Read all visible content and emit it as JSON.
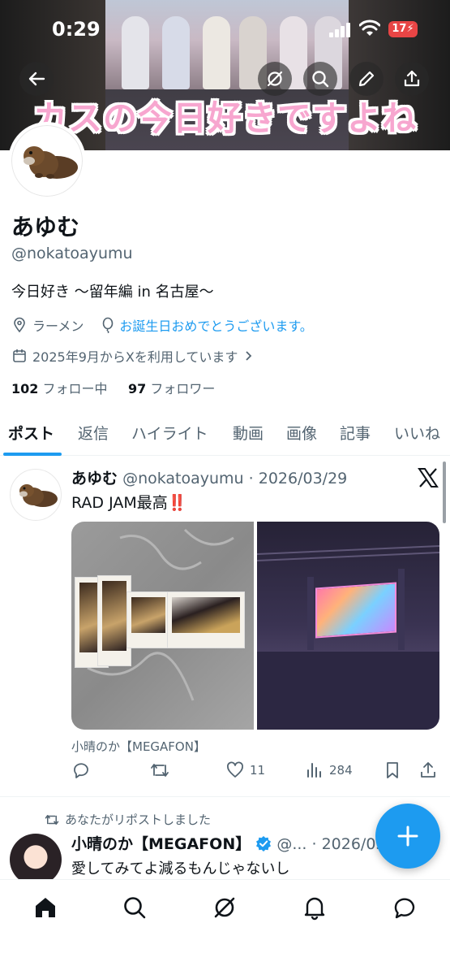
{
  "status_bar": {
    "time": "0:29",
    "battery": "17"
  },
  "banner": {
    "caption": "カスの今日好きですよね"
  },
  "profile": {
    "name": "あゆむ",
    "handle": "@nokatoayumu",
    "bio": "今日好き 〜留年編 in 名古屋〜",
    "location": "ラーメン",
    "birthday": "お誕生日おめでとうございます。",
    "joined": "2025年9月からXを利用しています",
    "following_count": "102",
    "following_label": "フォロー中",
    "followers_count": "97",
    "followers_label": "フォロワー"
  },
  "tabs": [
    {
      "label": "ポスト"
    },
    {
      "label": "返信"
    },
    {
      "label": "ハイライト"
    },
    {
      "label": "動画"
    },
    {
      "label": "画像"
    },
    {
      "label": "記事"
    },
    {
      "label": "いいね"
    }
  ],
  "post1": {
    "name": "あゆむ",
    "handle": "@nokatoayumu",
    "date": "· 2026/03/29",
    "text": "RAD JAM最高",
    "emoji": "‼️",
    "quote_source": "小晴のか【MEGAFON】",
    "likes": "11",
    "views": "284"
  },
  "post2": {
    "repost_note": "あなたがリポストしました",
    "name": "小晴のか【MEGAFON】",
    "handle": "@...",
    "date": "· 2026/03/",
    "text": "愛してみてよ減るもんじゃないし"
  },
  "colors": {
    "accent": "#1d9bf0",
    "text": "#0f1419",
    "secondary": "#536471",
    "battery": "#e84545"
  }
}
